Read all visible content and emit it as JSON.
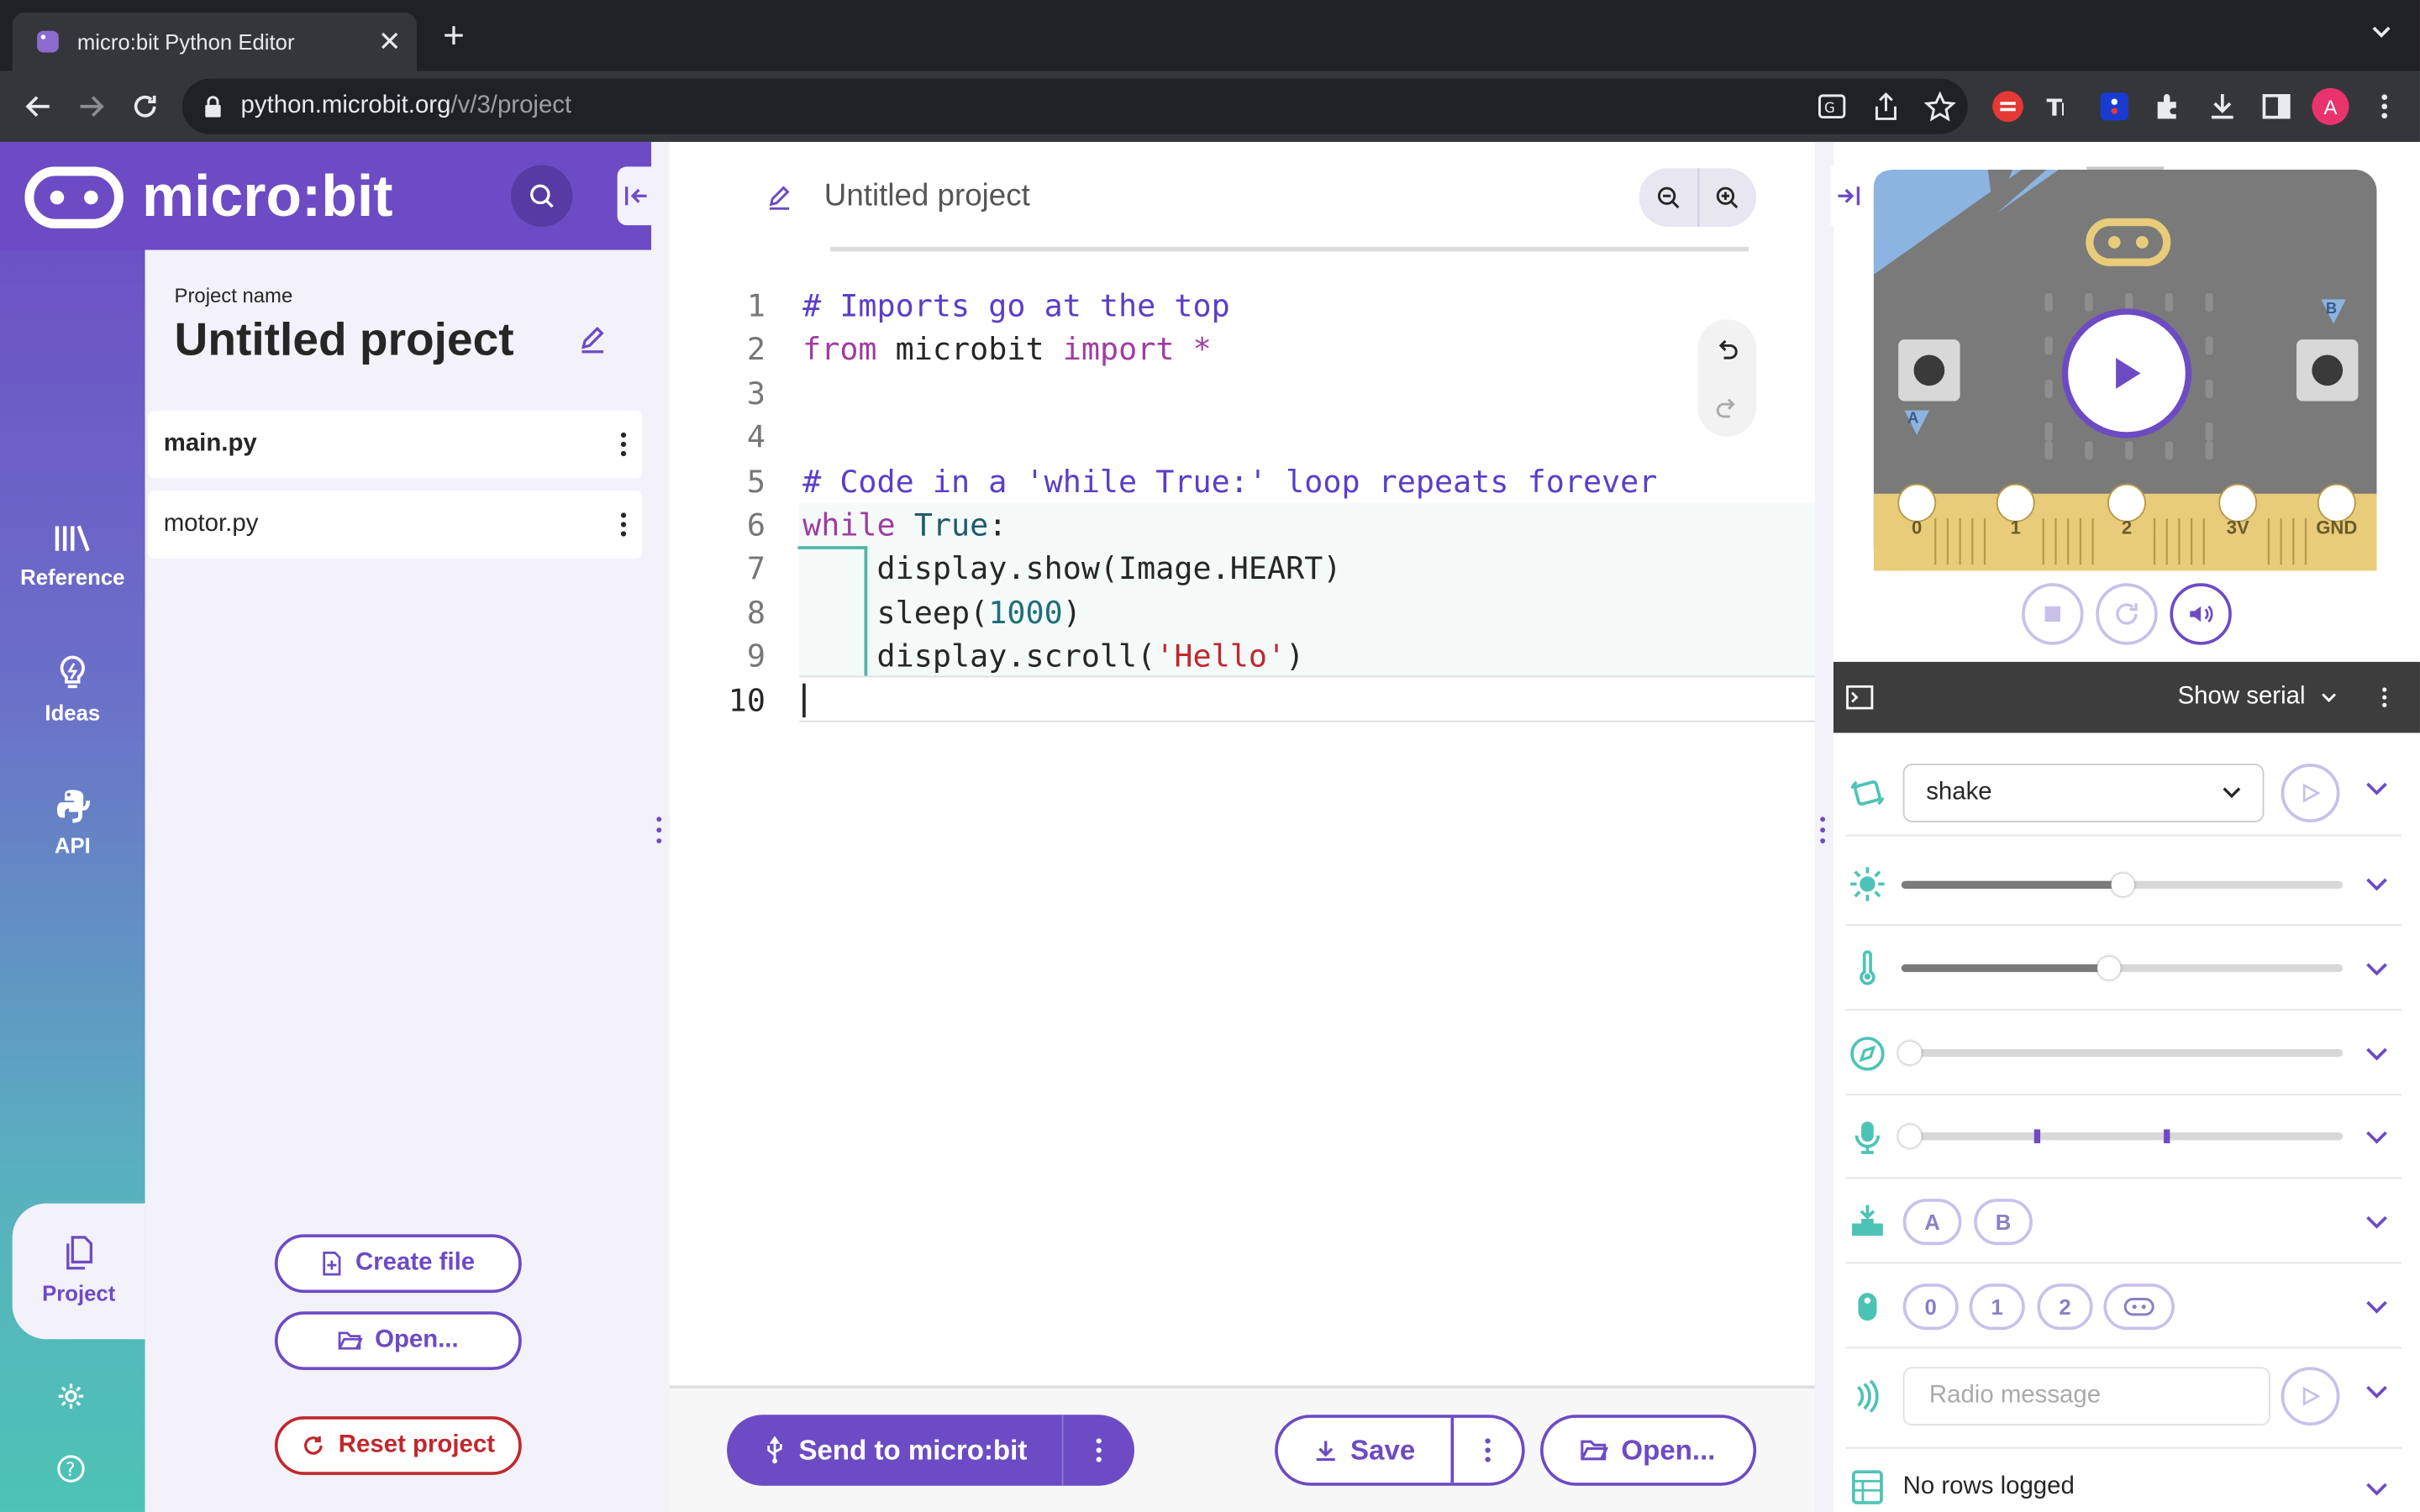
{
  "browser": {
    "tab_title": "micro:bit Python Editor",
    "url_host": "python.microbit.org",
    "url_path": "/v/3/project",
    "avatar_letter": "A"
  },
  "sidebar": {
    "logo_text": "micro:bit",
    "nav": [
      {
        "label": "Reference",
        "icon": "library-icon"
      },
      {
        "label": "Ideas",
        "icon": "lightbulb-icon"
      },
      {
        "label": "API",
        "icon": "python-icon"
      },
      {
        "label": "Project",
        "icon": "files-icon"
      }
    ]
  },
  "project": {
    "name_label": "Project name",
    "name": "Untitled project",
    "files": [
      "main.py",
      "motor.py"
    ],
    "create_file": "Create file",
    "open": "Open...",
    "reset": "Reset project"
  },
  "editor": {
    "title": "Untitled project",
    "lines": [
      {
        "n": "1",
        "html": "<span class='cm'># Imports go at the top</span>"
      },
      {
        "n": "2",
        "html": "<span class='kw'>from</span> microbit <span class='kw'>import</span> <span class='kw'>*</span>"
      },
      {
        "n": "3",
        "html": ""
      },
      {
        "n": "4",
        "html": ""
      },
      {
        "n": "5",
        "html": "<span class='cm'># Code in a 'while True:' loop repeats forever</span>"
      },
      {
        "n": "6",
        "html": "<span class='kw'>while</span> <span class='bi'>True</span>:"
      },
      {
        "n": "7",
        "html": "    display.show(Image.HEART)"
      },
      {
        "n": "8",
        "html": "    sleep(<span class='nm'>1000</span>)"
      },
      {
        "n": "9",
        "html": "    display.scroll(<span class='st'>'Hello'</span>)"
      },
      {
        "n": "10",
        "html": ""
      }
    ],
    "send": "Send to micro:bit",
    "save": "Save",
    "open": "Open..."
  },
  "simulator": {
    "pins": [
      "0",
      "1",
      "2",
      "3V",
      "GND"
    ],
    "button_a": "A",
    "button_b": "B",
    "serial_label": "Show serial",
    "gesture": "shake",
    "light_level": 0.5,
    "temperature_level": 0.47,
    "buttons": [
      "A",
      "B"
    ],
    "touch_pins": [
      "0",
      "1",
      "2"
    ],
    "radio_placeholder": "Radio message",
    "data_log": "No rows logged"
  }
}
